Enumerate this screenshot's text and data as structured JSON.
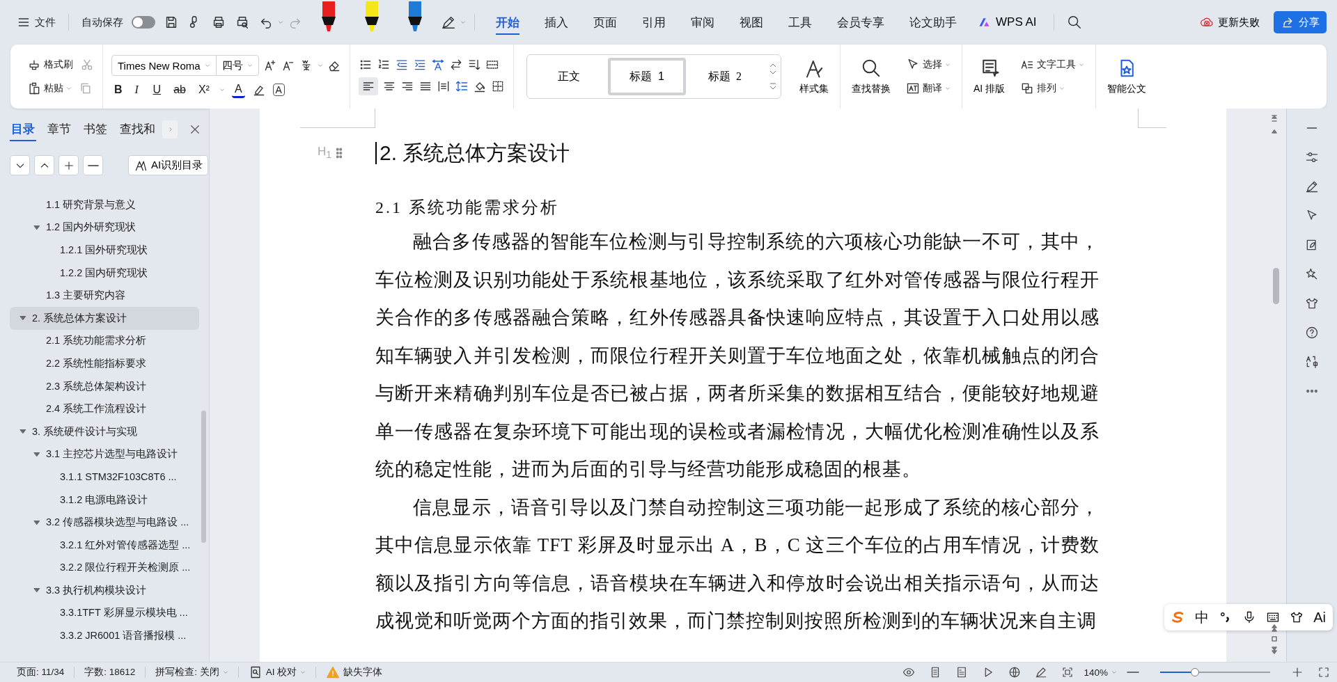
{
  "title_bar": {
    "file_menu": "文件",
    "autosave": {
      "label": "自动保存",
      "on": false
    },
    "markers": [
      {
        "color": "#e81e1e"
      },
      {
        "color": "#f5e61a"
      },
      {
        "color": "#1f7ad6"
      }
    ],
    "tabs": [
      {
        "label": "开始",
        "selected": true
      },
      {
        "label": "插入",
        "selected": false
      },
      {
        "label": "页面",
        "selected": false
      },
      {
        "label": "引用",
        "selected": false
      },
      {
        "label": "审阅",
        "selected": false
      },
      {
        "label": "视图",
        "selected": false
      },
      {
        "label": "工具",
        "selected": false
      },
      {
        "label": "会员专享",
        "selected": false
      },
      {
        "label": "论文助手",
        "selected": false
      }
    ],
    "ai_tab": "WPS AI",
    "sync_status": "更新失败",
    "share_button": "分享"
  },
  "ribbon": {
    "format_painter": "格式刷",
    "paste": "粘贴",
    "font_name": "Times New Roma",
    "font_size": "四号",
    "font_glyphs": [
      "B",
      "I",
      "U",
      "ab",
      "X²",
      "A",
      "A"
    ],
    "styles": [
      {
        "label": "正文",
        "selected": false
      },
      {
        "label": "标题  1",
        "selected": true
      },
      {
        "label": "标题  2",
        "selected": false
      }
    ],
    "style_set": "样式集",
    "find_replace": "查找替换",
    "select": "选择",
    "translate": "翻译",
    "ai_layout": "AI 排版",
    "text_tools": "文字工具",
    "arrange": "排列",
    "smart_doc": "智能公文"
  },
  "sidebar": {
    "tabs": [
      {
        "label": "目录",
        "selected": true
      },
      {
        "label": "章节",
        "selected": false
      },
      {
        "label": "书签",
        "selected": false
      },
      {
        "label": "查找和",
        "selected": false
      }
    ],
    "ai_toc_button": "AI识别目录",
    "toc": [
      {
        "children": [
          {
            "title": "1.1 研究背景与意义",
            "selected": false
          },
          {
            "title": "1.2 国内外研究现状",
            "selected": false,
            "expanded": true,
            "children": [
              {
                "title": "1.2.1 国外研究现状",
                "selected": false
              },
              {
                "title": "1.2.2 国内研究现状",
                "selected": false
              }
            ]
          },
          {
            "title": "1.3 主要研究内容",
            "selected": false
          }
        ]
      },
      {
        "title": "2.  系统总体方案设计",
        "selected": true,
        "expanded": true,
        "children": [
          {
            "title": "2.1 系统功能需求分析",
            "selected": false
          },
          {
            "title": "2.2 系统性能指标要求",
            "selected": false
          },
          {
            "title": "2.3 系统总体架构设计",
            "selected": false
          },
          {
            "title": "2.4 系统工作流程设计",
            "selected": false
          }
        ]
      },
      {
        "title": "3.  系统硬件设计与实现",
        "selected": false,
        "expanded": true,
        "children": [
          {
            "title": "3.1 主控芯片选型与电路设计",
            "selected": false,
            "expanded": true,
            "children": [
              {
                "title": "3.1.1 STM32F103C8T6 ...",
                "selected": false
              },
              {
                "title": "3.1.2 电源电路设计",
                "selected": false
              }
            ]
          },
          {
            "title": "3.2 传感器模块选型与电路设 ...",
            "selected": false,
            "expanded": true,
            "children": [
              {
                "title": "3.2.1 红外对管传感器选型 ...",
                "selected": false
              },
              {
                "title": "3.2.2 限位行程开关检测原 ...",
                "selected": false
              }
            ]
          },
          {
            "title": "3.3 执行机构模块设计",
            "selected": false,
            "expanded": true,
            "children": [
              {
                "title": "3.3.1TFT 彩屏显示模块电 ...",
                "selected": false
              },
              {
                "title": "3.3.2 JR6001 语音播报模 ...",
                "selected": false
              }
            ]
          }
        ]
      }
    ]
  },
  "document": {
    "heading_marker": "H$_{1}$",
    "heading": "2.  系统总体方案设计",
    "subheading": "2.1 系统功能需求分析",
    "paragraphs": [
      "融合多传感器的智能车位检测与引导控制系统的六项核心功能缺一不可，其中，车位检测及识别功能处于系统根基地位，该系统采取了红外对管传感器与限位行程开关合作的多传感器融合策略，红外传感器具备快速响应特点，其设置于入口处用以感知车辆驶入并引发检测，而限位行程开关则置于车位地面之处，依靠机械触点的闭合与断开来精确判别车位是否已被占据，两者所采集的数据相互结合，便能较好地规避单一传感器在复杂环境下可能出现的误检或者漏检情况，大幅优化检测准确性以及系统的稳定性能，进而为后面的引导与经营功能形成稳固的根基。",
      "信息显示，语音引导以及门禁自动控制这三项功能一起形成了系统的核心部分，其中信息显示依靠 TFT 彩屏及时显示出 A，B，C 这三个车位的占用车情况，计费数额以及指引方向等信息，语音模块在车辆进入和停放时会说出相关指示语句，从而达成视觉和听觉两个方面的指引效果，而门禁控制则按照所检测到的车辆状况来自主调"
    ]
  },
  "ime_bar": {
    "mode": "中",
    "ai": "Ai"
  },
  "status_bar": {
    "page": "页面: 11/34",
    "word_count": "字数: 18612",
    "spell_check": "拼写检查: 关闭",
    "ai_proofread": "AI 校对",
    "missing_fonts": "缺失字体",
    "zoom": "140%",
    "zoom_level": {
      "level": 0.33
    }
  }
}
